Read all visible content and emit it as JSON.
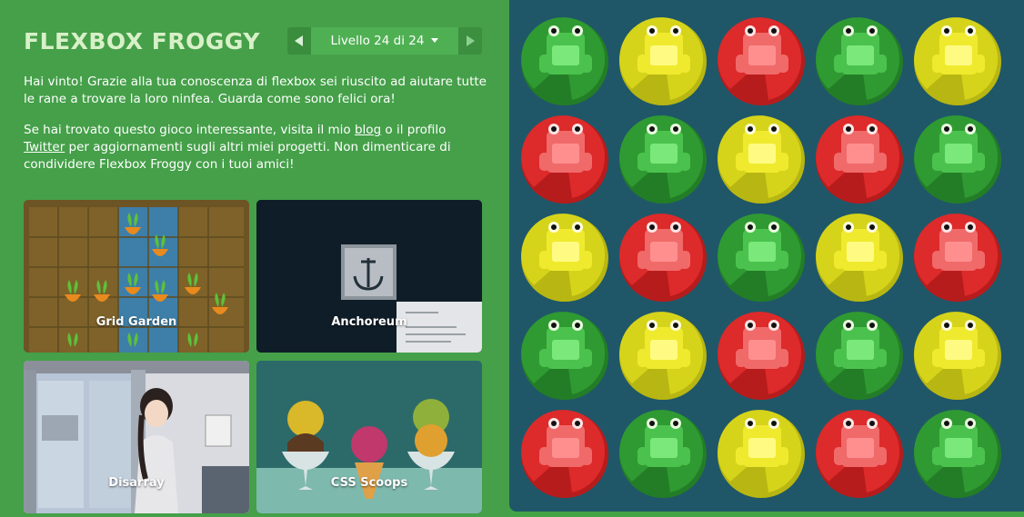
{
  "header": {
    "title": "FLEXBOX FROGGY",
    "level_label": "Livello 24 di 24",
    "prev_icon": "triangle-left-icon",
    "next_icon": "triangle-right-icon",
    "dropdown_icon": "caret-down-icon"
  },
  "messages": {
    "win": "Hai vinto! Grazie alla tua conoscenza di flexbox sei riuscito ad aiutare tutte le rane a trovare la loro ninfea. Guarda come sono felici ora!",
    "share_before_blog": "Se hai trovato questo gioco interessante, visita il mio ",
    "blog_link": "blog",
    "share_between": " o il profilo ",
    "twitter_link": "Twitter",
    "share_after": " per aggiornamenti sugli altri miei progetti. Non dimenticare di condividere Flexbox Froggy con i tuoi amici!"
  },
  "games": [
    {
      "label": "Grid Garden"
    },
    {
      "label": "Anchoreum"
    },
    {
      "label": "Disarray"
    },
    {
      "label": "CSS Scoops"
    }
  ],
  "colors": {
    "background": "#45a049",
    "pond": "#1f5768",
    "green": "#2e9630",
    "red": "#d72c2c",
    "yellow": "#d8d616"
  },
  "board": {
    "rows": [
      [
        "green",
        "yellow",
        "red",
        "green",
        "yellow"
      ],
      [
        "red",
        "green",
        "yellow",
        "red",
        "green"
      ],
      [
        "yellow",
        "red",
        "green",
        "yellow",
        "red"
      ],
      [
        "green",
        "yellow",
        "red",
        "green",
        "yellow"
      ],
      [
        "red",
        "green",
        "yellow",
        "red",
        "green"
      ]
    ]
  }
}
